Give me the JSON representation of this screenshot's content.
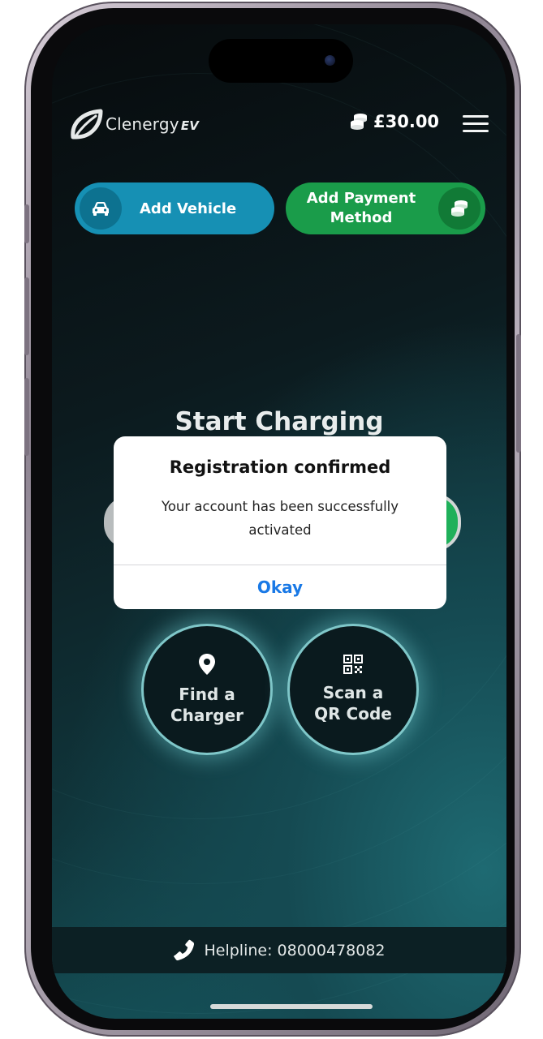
{
  "app": {
    "logo_text": "Clenergy",
    "logo_suffix": "EV"
  },
  "header": {
    "balance": "£30.00",
    "balance_icon": "coins-icon",
    "menu_icon": "hamburger-menu-icon"
  },
  "actions": {
    "add_vehicle_label": "Add Vehicle",
    "add_vehicle_icon": "car-icon",
    "add_payment_label": "Add Payment Method",
    "add_payment_icon": "coins-icon"
  },
  "main": {
    "title": "Start Charging",
    "find_charger_label": "Find a Charger",
    "find_charger_icon": "map-pin-icon",
    "scan_qr_label": "Scan a QR Code",
    "scan_qr_icon": "qr-code-icon"
  },
  "modal": {
    "title": "Registration confirmed",
    "message": "Your account has been successfully activated",
    "ok_label": "Okay"
  },
  "footer": {
    "helpline": "Helpline: 08000478082",
    "helpline_icon": "phone-icon"
  },
  "colors": {
    "add_vehicle": "#1690b4",
    "add_payment": "#1a9c4a",
    "modal_action": "#1979e6",
    "ring_glow": "#7fc7c9"
  }
}
